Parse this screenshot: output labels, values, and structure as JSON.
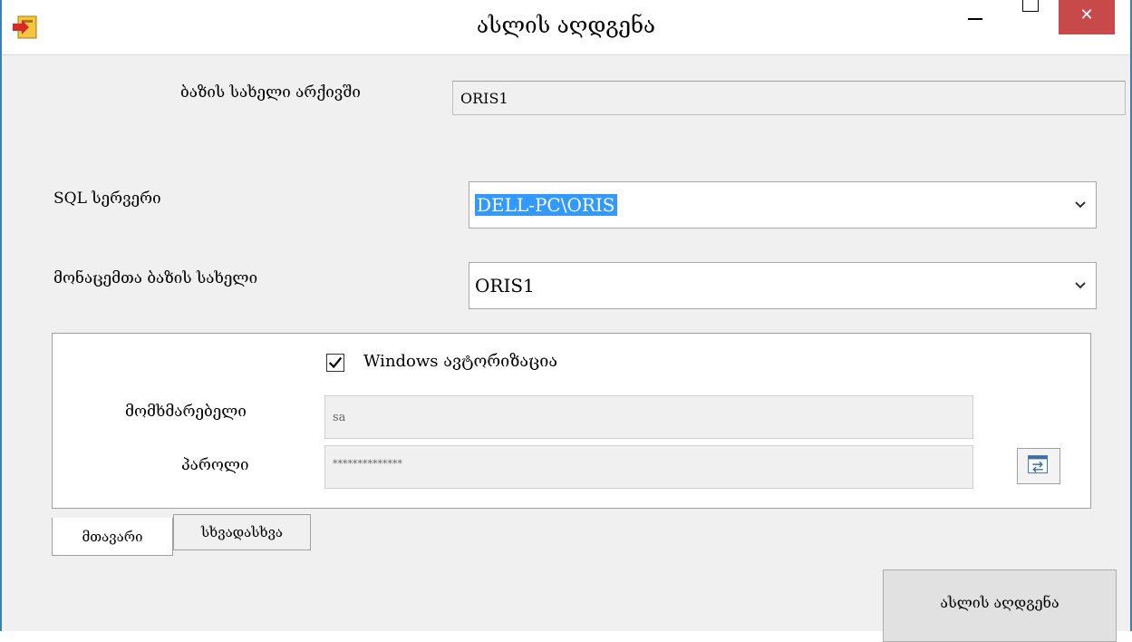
{
  "window": {
    "title": "ასლის აღდგენა",
    "close_label": "✕"
  },
  "archive_db": {
    "label": "ბაზის სახელი არქივში",
    "value": "ORIS1"
  },
  "sql_server": {
    "label": "SQL სერვერი",
    "value": "DELL-PC\\ORIS"
  },
  "database": {
    "label": "მონაცემთა ბაზის სახელი",
    "value": "ORIS1"
  },
  "auth": {
    "windows_auth_label": "Windows ავტორიზაცია",
    "windows_auth_checked": true,
    "user_label": "მომხმარებელი",
    "user_value": "sa",
    "password_label": "პაროლი",
    "password_value": "**************"
  },
  "tabs": [
    {
      "label": "მთავარი",
      "active": true
    },
    {
      "label": "სხვადასხვა",
      "active": false
    }
  ],
  "actions": {
    "restore_label": "ასლის აღდგენა"
  },
  "colors": {
    "close_red": "#c7494a",
    "selection_blue": "#3399ff",
    "border_blue": "#3c7fb1"
  }
}
